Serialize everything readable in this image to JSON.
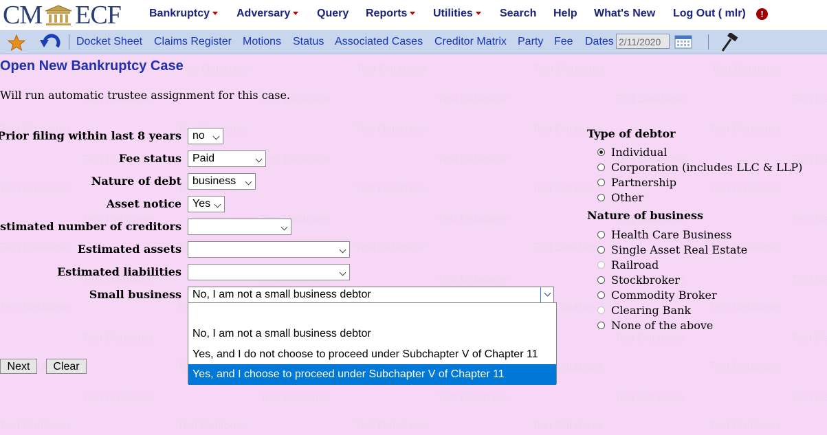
{
  "header": {
    "logo_left": "CM",
    "logo_right": "ECF",
    "menu": [
      {
        "label": "Bankruptcy",
        "caret": true
      },
      {
        "label": "Adversary",
        "caret": true
      },
      {
        "label": "Query",
        "caret": false
      },
      {
        "label": "Reports",
        "caret": true
      },
      {
        "label": "Utilities",
        "caret": true
      },
      {
        "label": "Search",
        "caret": false
      },
      {
        "label": "Help",
        "caret": false
      },
      {
        "label": "What's New",
        "caret": false
      },
      {
        "label": "Log Out ( mlr)",
        "caret": false
      }
    ],
    "alert_glyph": "!"
  },
  "toolbar": {
    "links": [
      "Docket Sheet",
      "Claims Register",
      "Motions",
      "Status",
      "Associated Cases",
      "Creditor Matrix",
      "Party",
      "Fee",
      "Dates"
    ],
    "date_value": "2/11/2020",
    "icons": [
      "star-icon",
      "back-arrow-icon",
      "calendar-icon",
      "hammer-icon"
    ]
  },
  "watermark": "Test Database",
  "page": {
    "title": "Open New Bankruptcy Case",
    "note": "Will run automatic trustee assignment for this case."
  },
  "form": {
    "prior_filing": {
      "label": "Prior filing within last 8 years",
      "value": "no"
    },
    "fee_status": {
      "label": "Fee status",
      "value": "Paid"
    },
    "nature_of_debt": {
      "label": "Nature of debt",
      "value": "business"
    },
    "asset_notice": {
      "label": "Asset notice",
      "value": "Yes"
    },
    "est_creditors": {
      "label": "Estimated number of creditors",
      "value": ""
    },
    "est_assets": {
      "label": "Estimated assets",
      "value": ""
    },
    "est_liabilities": {
      "label": "Estimated liabilities",
      "value": ""
    },
    "small_business": {
      "label": "Small business",
      "value": "No, I am not a small business debtor",
      "options": [
        "",
        "No, I am not a small business debtor",
        "Yes, and I do not choose to proceed under Subchapter V of Chapter 11",
        "Yes, and I choose to proceed under Subchapter V of Chapter 11"
      ],
      "highlighted_index": 3
    },
    "buttons": {
      "next": "Next",
      "clear": "Clear"
    }
  },
  "debtor_type": {
    "heading": "Type of debtor",
    "options": [
      "Individual",
      "Corporation (includes LLC & LLP)",
      "Partnership",
      "Other"
    ],
    "selected": "Individual"
  },
  "nature_of_business": {
    "heading": "Nature of business",
    "options": [
      "Health Care Business",
      "Single Asset Real Estate",
      "Railroad",
      "Stockbroker",
      "Commodity Broker",
      "Clearing Bank",
      "None of the above"
    ],
    "disabled": [
      "Railroad",
      "Clearing Bank"
    ]
  }
}
